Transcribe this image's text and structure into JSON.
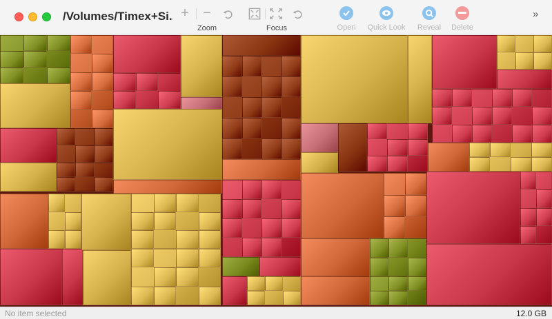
{
  "window": {
    "title": "/Volumes/Timex+Si..."
  },
  "toolbar": {
    "zoom_label": "Zoom",
    "focus_label": "Focus",
    "zoom_in": "+",
    "zoom_out": "−",
    "actions": [
      {
        "label": "Open",
        "icon": "eye-check-icon",
        "color": "#7ab8e8"
      },
      {
        "label": "Quick Look",
        "icon": "eye-icon",
        "color": "#7ab8e8"
      },
      {
        "label": "Reveal",
        "icon": "magnifier-icon",
        "color": "#7ab8e8"
      },
      {
        "label": "Delete",
        "icon": "minus-circle-icon",
        "color": "#f08a8a"
      }
    ],
    "overflow": "»"
  },
  "status": {
    "selection": "No item selected",
    "size": "12.0 GB"
  },
  "colors": {
    "red": "#c8384a",
    "orange": "#d0683a",
    "gold": "#d6b24c",
    "olive": "#7a8a1e",
    "brown": "#8a3612",
    "pink": "#c87078"
  }
}
